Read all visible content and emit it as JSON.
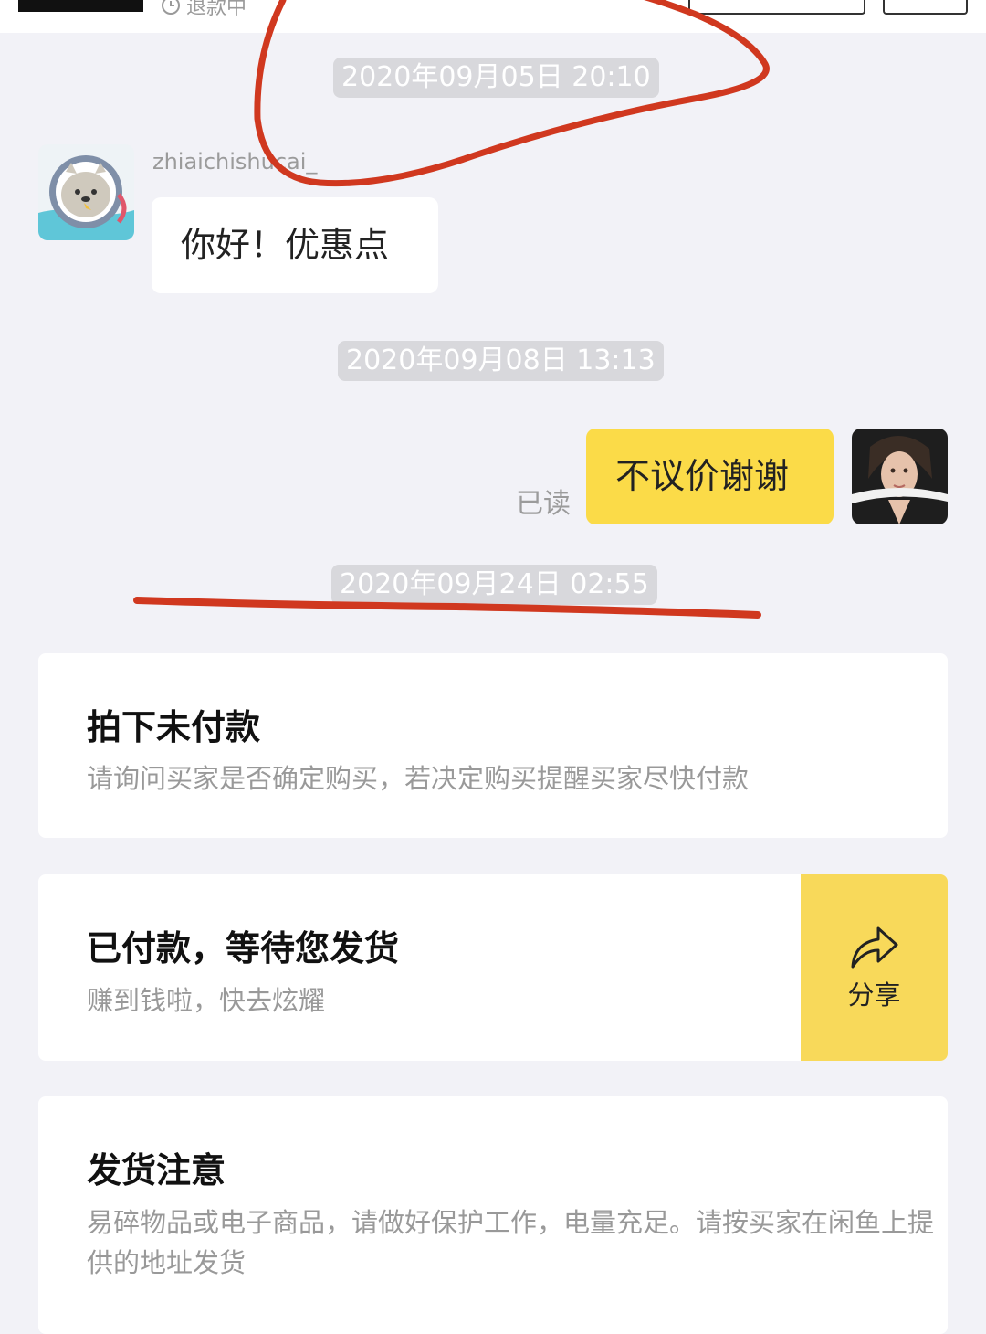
{
  "header": {
    "refund_status": "退款中"
  },
  "chat": {
    "time_1": "2020年09月05日 20:10",
    "username": "zhiaichishucai_",
    "message_1": "你好！优惠点",
    "time_2": "2020年09月08日 13:13",
    "message_2": "不议价谢谢",
    "read_status": "已读",
    "time_3": "2020年09月24日 02:55"
  },
  "cards": {
    "unpaid": {
      "title": "拍下未付款",
      "desc": "请询问买家是否确定购买，若决定购买提醒买家尽快付款"
    },
    "paid": {
      "title": "已付款，等待您发货",
      "desc": "赚到钱啦，快去炫耀",
      "share_label": "分享"
    },
    "shipping_note": {
      "title": "发货注意",
      "desc": "易碎物品或电子商品，请做好保护工作，电量充足。请按买家在闲鱼上提供的地址发货"
    }
  },
  "colors": {
    "background": "#f2f2f7",
    "accent_yellow": "#fbdb48",
    "annotation_red": "#d0381f"
  }
}
